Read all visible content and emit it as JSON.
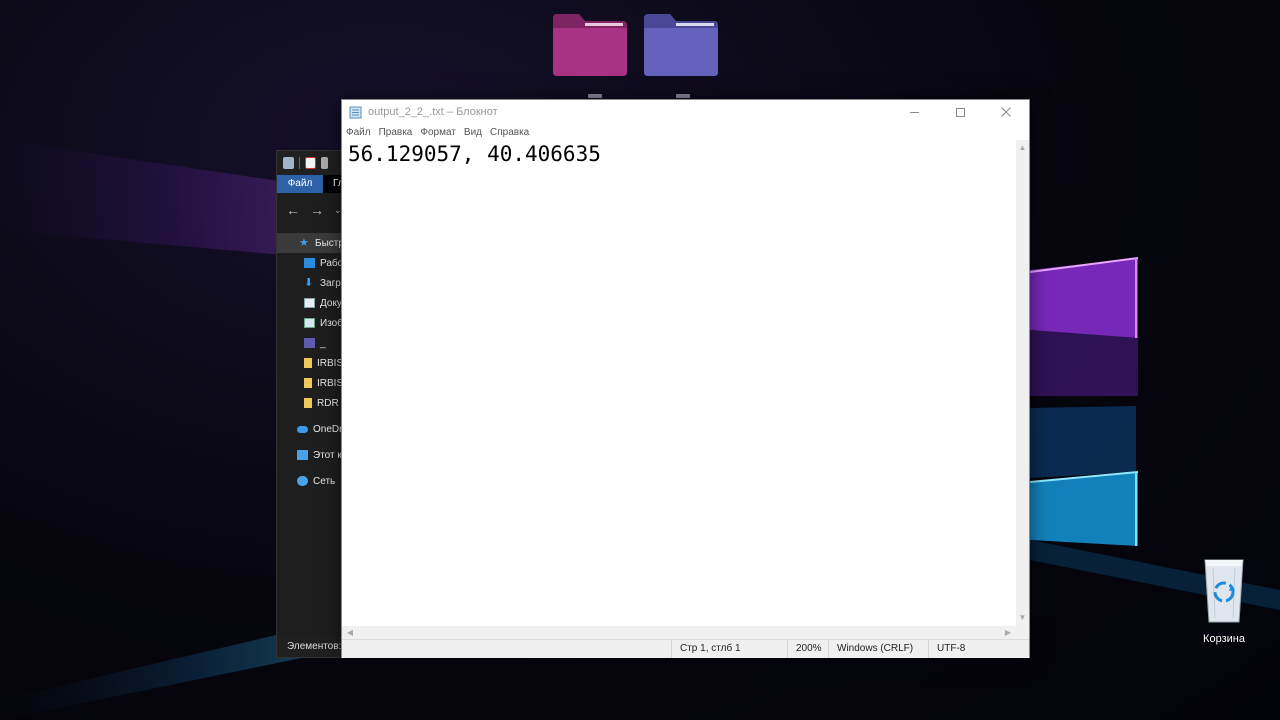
{
  "desktop": {
    "icons": [
      {
        "name": "",
        "color": "#8e2f6e"
      },
      {
        "name": "",
        "color": "#5a56a8"
      }
    ],
    "recycle_bin": {
      "label": "Корзина"
    }
  },
  "explorer": {
    "ribbon": {
      "file_tab": "Файл",
      "second_tab": "Гл"
    },
    "nav_tree": [
      {
        "label": "Быстр",
        "icon": "star-icon"
      },
      {
        "label": "Рабо",
        "icon": "desktop-icon"
      },
      {
        "label": "Загр",
        "icon": "download-icon"
      },
      {
        "label": "Доку",
        "icon": "document-icon"
      },
      {
        "label": "Изоб",
        "icon": "image-icon"
      },
      {
        "label": "_",
        "icon": "folder-icon"
      },
      {
        "label": "IRBIS",
        "icon": "folder-icon"
      },
      {
        "label": "IRBIS",
        "icon": "folder-icon"
      },
      {
        "label": "RDR",
        "icon": "folder-icon"
      },
      {
        "label": "OneDr",
        "icon": "cloud-icon"
      },
      {
        "label": "Этот к",
        "icon": "computer-icon"
      },
      {
        "label": "Сеть",
        "icon": "network-icon"
      }
    ],
    "status": "Элементов:"
  },
  "notepad": {
    "title": "output_2_2_.txt – Блокнот",
    "menu": [
      "Файл",
      "Правка",
      "Формат",
      "Вид",
      "Справка"
    ],
    "content": "56.129057, 40.406635",
    "status": {
      "position": "Стр 1, стлб 1",
      "zoom": "200%",
      "line_endings": "Windows (CRLF)",
      "encoding": "UTF-8"
    }
  }
}
